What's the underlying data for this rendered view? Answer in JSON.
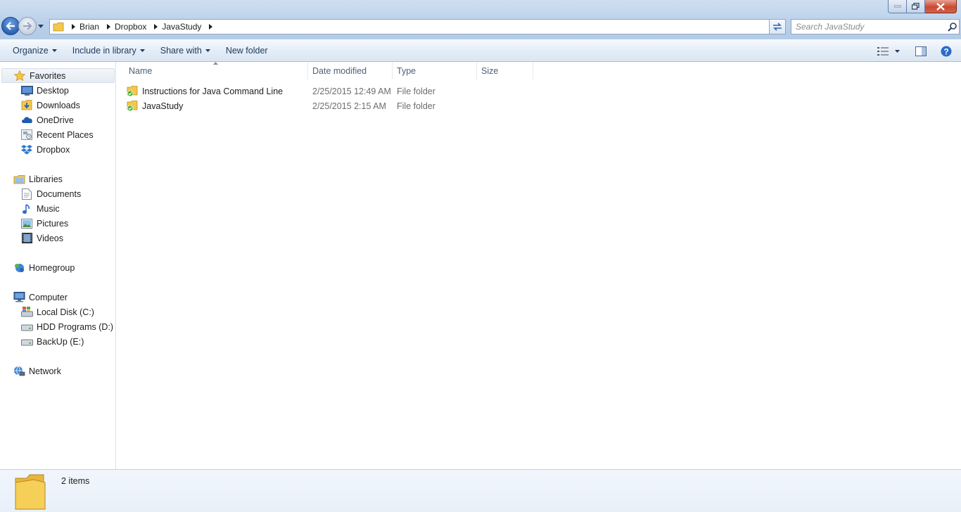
{
  "address_bar": {
    "crumbs": [
      "Brian",
      "Dropbox",
      "JavaStudy"
    ]
  },
  "search": {
    "placeholder": "Search JavaStudy"
  },
  "toolbar": {
    "organize": "Organize",
    "include_in_library": "Include in library",
    "share_with": "Share with",
    "new_folder": "New folder"
  },
  "nav_pane": {
    "favorites": {
      "label": "Favorites",
      "items": [
        "Desktop",
        "Downloads",
        "OneDrive",
        "Recent Places",
        "Dropbox"
      ]
    },
    "libraries": {
      "label": "Libraries",
      "items": [
        "Documents",
        "Music",
        "Pictures",
        "Videos"
      ]
    },
    "homegroup": {
      "label": "Homegroup"
    },
    "computer": {
      "label": "Computer",
      "items": [
        "Local Disk (C:)",
        "HDD Programs (D:)",
        "BackUp (E:)"
      ]
    },
    "network": {
      "label": "Network"
    }
  },
  "file_list": {
    "columns": [
      "Name",
      "Date modified",
      "Type",
      "Size"
    ],
    "rows": [
      {
        "name": "Instructions for Java Command Line",
        "date": "2/25/2015 12:49 AM",
        "type": "File folder"
      },
      {
        "name": "JavaStudy",
        "date": "2/25/2015 2:15 AM",
        "type": "File folder"
      }
    ]
  },
  "details_pane": {
    "count": "2 items"
  },
  "colors": {
    "accent": "#2c62b5",
    "toolbar_text": "#1e395b",
    "folder_yellow": "#f3c84c",
    "sync_green": "#3fae2a"
  }
}
